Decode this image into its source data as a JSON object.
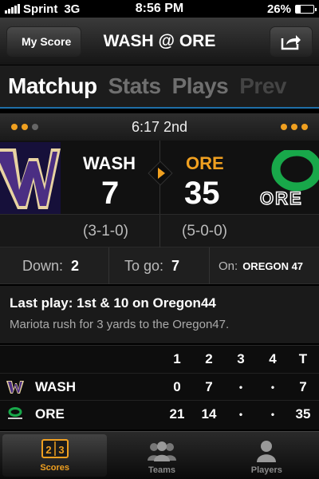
{
  "status_bar": {
    "carrier": "Sprint",
    "network": "3G",
    "time": "8:56 PM",
    "battery": "26%",
    "battery_level": 0.26
  },
  "nav": {
    "back_label": "My Score",
    "title": "WASH @ ORE",
    "share_icon": "share-icon"
  },
  "tabs": [
    {
      "label": "Matchup",
      "active": true
    },
    {
      "label": "Stats",
      "active": false
    },
    {
      "label": "Plays",
      "active": false
    },
    {
      "label": "Prev",
      "active": false
    }
  ],
  "game_clock": {
    "text": "6:17 2nd",
    "away_timeouts": 2,
    "home_timeouts": 3
  },
  "teams": {
    "away": {
      "abbr": "WASH",
      "score": "7",
      "record": "(3-1-0)"
    },
    "home": {
      "abbr": "ORE",
      "score": "35",
      "record": "(5-0-0)",
      "logo_text": "ORE"
    }
  },
  "down_distance": {
    "down_label": "Down:",
    "down_value": "2",
    "togo_label": "To go:",
    "togo_value": "7",
    "on_label": "On:",
    "on_value": "OREGON 47"
  },
  "last_play": {
    "title": "Last play: 1st & 10 on Oregon44",
    "description": "Mariota rush for 3 yards to the Oregon47."
  },
  "box_score": {
    "headers": [
      "1",
      "2",
      "3",
      "4",
      "T"
    ],
    "rows": [
      {
        "team": "WASH",
        "scores": [
          "0",
          "7",
          "•",
          "•",
          "7"
        ]
      },
      {
        "team": "ORE",
        "scores": [
          "21",
          "14",
          "•",
          "•",
          "35"
        ]
      }
    ]
  },
  "tab_bar": [
    {
      "label": "Scores",
      "icon": "scoreboard-icon",
      "active": true
    },
    {
      "label": "Teams",
      "icon": "people-icon",
      "active": false
    },
    {
      "label": "Players",
      "icon": "person-icon",
      "active": false
    }
  ],
  "colors": {
    "accent": "#f0a020",
    "tab_underline": "#1f6fa8",
    "washington_purple": "#4b2e83",
    "washington_gold": "#e8d3a2",
    "oregon_green": "#18a84a"
  }
}
